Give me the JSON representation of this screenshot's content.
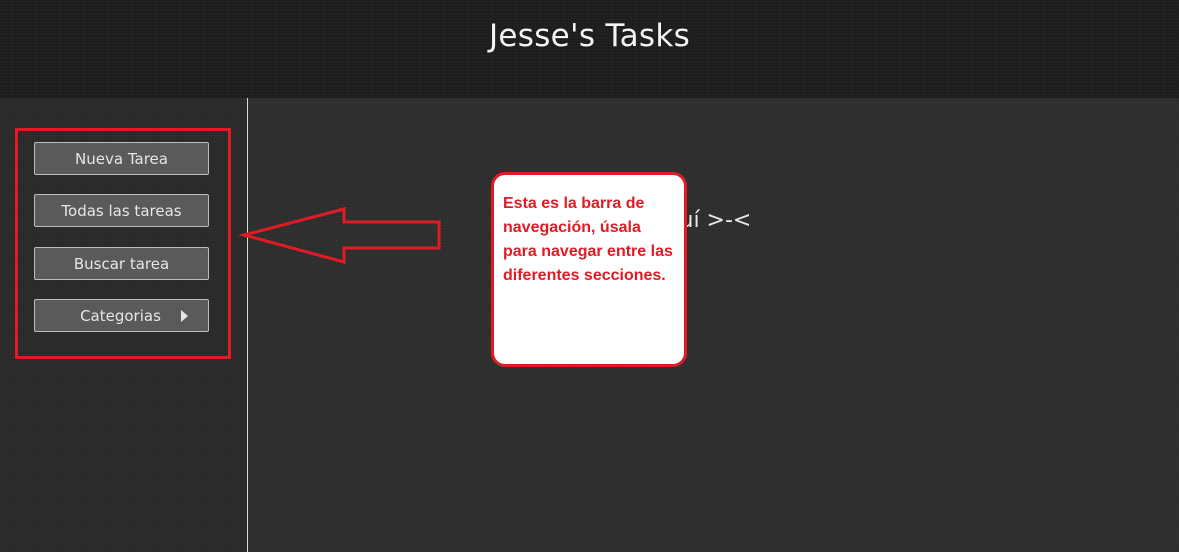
{
  "header": {
    "title": "Jesse's Tasks"
  },
  "sidebar": {
    "buttons": [
      {
        "label": "Nueva Tarea"
      },
      {
        "label": "Todas las tareas"
      },
      {
        "label": "Buscar tarea"
      },
      {
        "label": "Categorias",
        "icon": "caret-right-icon"
      }
    ]
  },
  "main": {
    "message_visible": "nostrar aquí >-<"
  },
  "annotation": {
    "text": "Esta es la barra de navegación, úsala para navegar entre las diferentes secciones.",
    "color": "#e01b24"
  }
}
